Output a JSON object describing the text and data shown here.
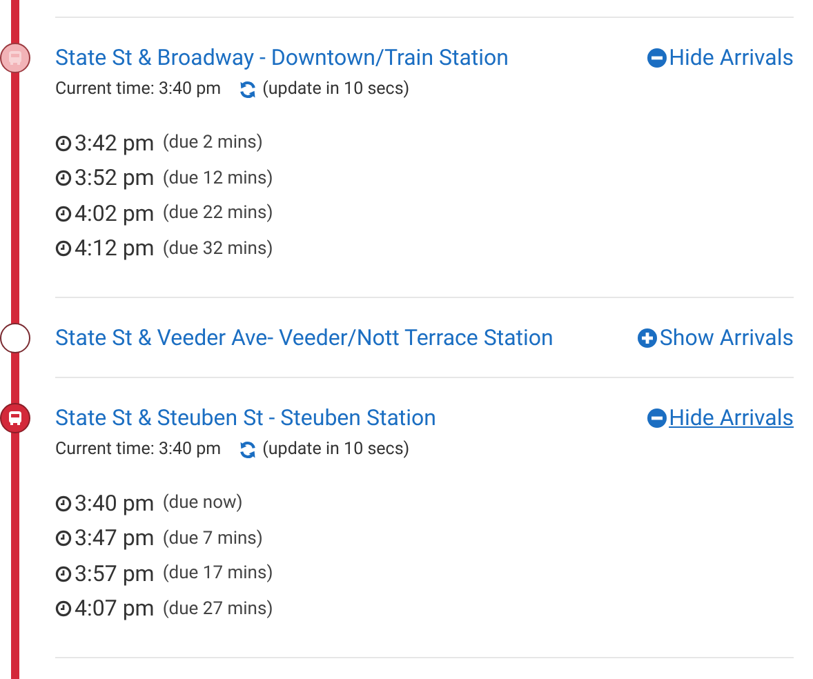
{
  "stops": [
    {
      "name": "State St & Broadway - Downtown/Train Station",
      "kind": "faded_bus",
      "expanded": true,
      "hovered": false,
      "toggle_label": "Hide Arrivals",
      "current_time": "Current time: 3:40 pm",
      "update_note": "(update in 10 secs)",
      "arrivals": [
        {
          "time": "3:42 pm",
          "due": "(due 2 mins)"
        },
        {
          "time": "3:52 pm",
          "due": "(due 12 mins)"
        },
        {
          "time": "4:02 pm",
          "due": "(due 22 mins)"
        },
        {
          "time": "4:12 pm",
          "due": "(due 32 mins)"
        }
      ]
    },
    {
      "name": "State St & Veeder Ave- Veeder/Nott Terrace Station",
      "kind": "empty",
      "expanded": false,
      "hovered": false,
      "toggle_label": "Show Arrivals"
    },
    {
      "name": "State St & Steuben St - Steuben Station",
      "kind": "bus",
      "expanded": true,
      "hovered": true,
      "toggle_label": "Hide Arrivals",
      "current_time": "Current time: 3:40 pm",
      "update_note": "(update in 10 secs)",
      "arrivals": [
        {
          "time": "3:40 pm",
          "due": "(due now)"
        },
        {
          "time": "3:47 pm",
          "due": "(due 7 mins)"
        },
        {
          "time": "3:57 pm",
          "due": "(due 17 mins)"
        },
        {
          "time": "4:07 pm",
          "due": "(due 27 mins)"
        }
      ]
    }
  ]
}
